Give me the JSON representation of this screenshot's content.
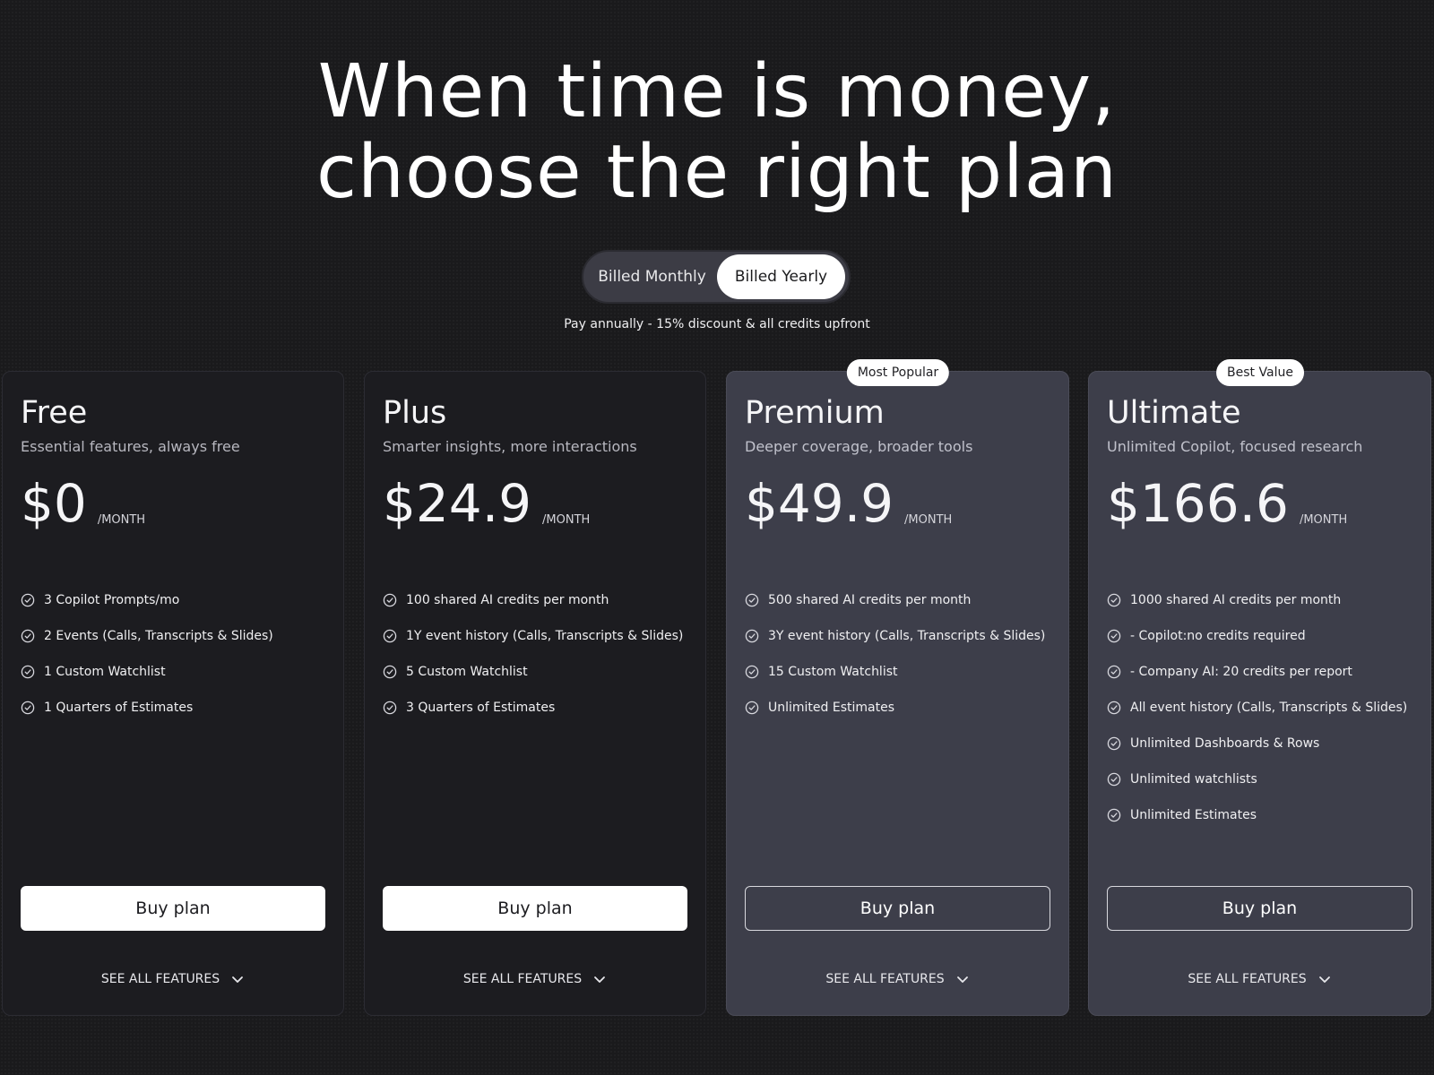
{
  "hero": {
    "line1": "When time is money,",
    "line2": "choose the right plan"
  },
  "billing": {
    "monthly_label": "Billed Monthly",
    "yearly_label": "Billed Yearly",
    "selected": "Billed Yearly",
    "note": "Pay annually - 15% discount & all credits upfront"
  },
  "plans": [
    {
      "name": "Free",
      "subtitle": "Essential features, always free",
      "price": "$0",
      "period": "/MONTH",
      "ribbon": "",
      "features": [
        "3 Copilot Prompts/mo",
        "2 Events (Calls, Transcripts & Slides)",
        "1 Custom Watchlist",
        "1 Quarters of Estimates"
      ],
      "button": "Buy plan",
      "see_all": "SEE ALL FEATURES"
    },
    {
      "name": "Plus",
      "subtitle": "Smarter insights, more interactions",
      "price": "$24.9",
      "period": "/MONTH",
      "ribbon": "",
      "features": [
        "100 shared AI credits per month",
        "1Y event history (Calls, Transcripts & Slides)",
        "5 Custom Watchlist",
        "3 Quarters of Estimates"
      ],
      "button": "Buy plan",
      "see_all": "SEE ALL FEATURES"
    },
    {
      "name": "Premium",
      "subtitle": "Deeper coverage, broader tools",
      "price": "$49.9",
      "period": "/MONTH",
      "ribbon": "Most Popular",
      "features": [
        "500 shared AI credits per month",
        "3Y event history (Calls, Transcripts & Slides)",
        "15 Custom Watchlist",
        "Unlimited Estimates"
      ],
      "button": "Buy plan",
      "see_all": "SEE ALL FEATURES"
    },
    {
      "name": "Ultimate",
      "subtitle": "Unlimited Copilot, focused research",
      "price": "$166.6",
      "period": "/MONTH",
      "ribbon": "Best Value",
      "features": [
        "1000 shared AI credits per month",
        "- Copilot:no credits required",
        "- Company AI: 20 credits per report",
        "All event history (Calls, Transcripts & Slides)",
        "Unlimited Dashboards & Rows",
        "Unlimited watchlists",
        "Unlimited Estimates"
      ],
      "button": "Buy plan",
      "see_all": "SEE ALL FEATURES"
    }
  ],
  "icons": {
    "feature": "check-circle-icon",
    "expand": "chevron-down-icon"
  },
  "colors": {
    "background": "#1a1a1c",
    "card_dark": "#1c1c20",
    "card_highlight": "#3d3e4a",
    "accent_white": "#ffffff"
  }
}
